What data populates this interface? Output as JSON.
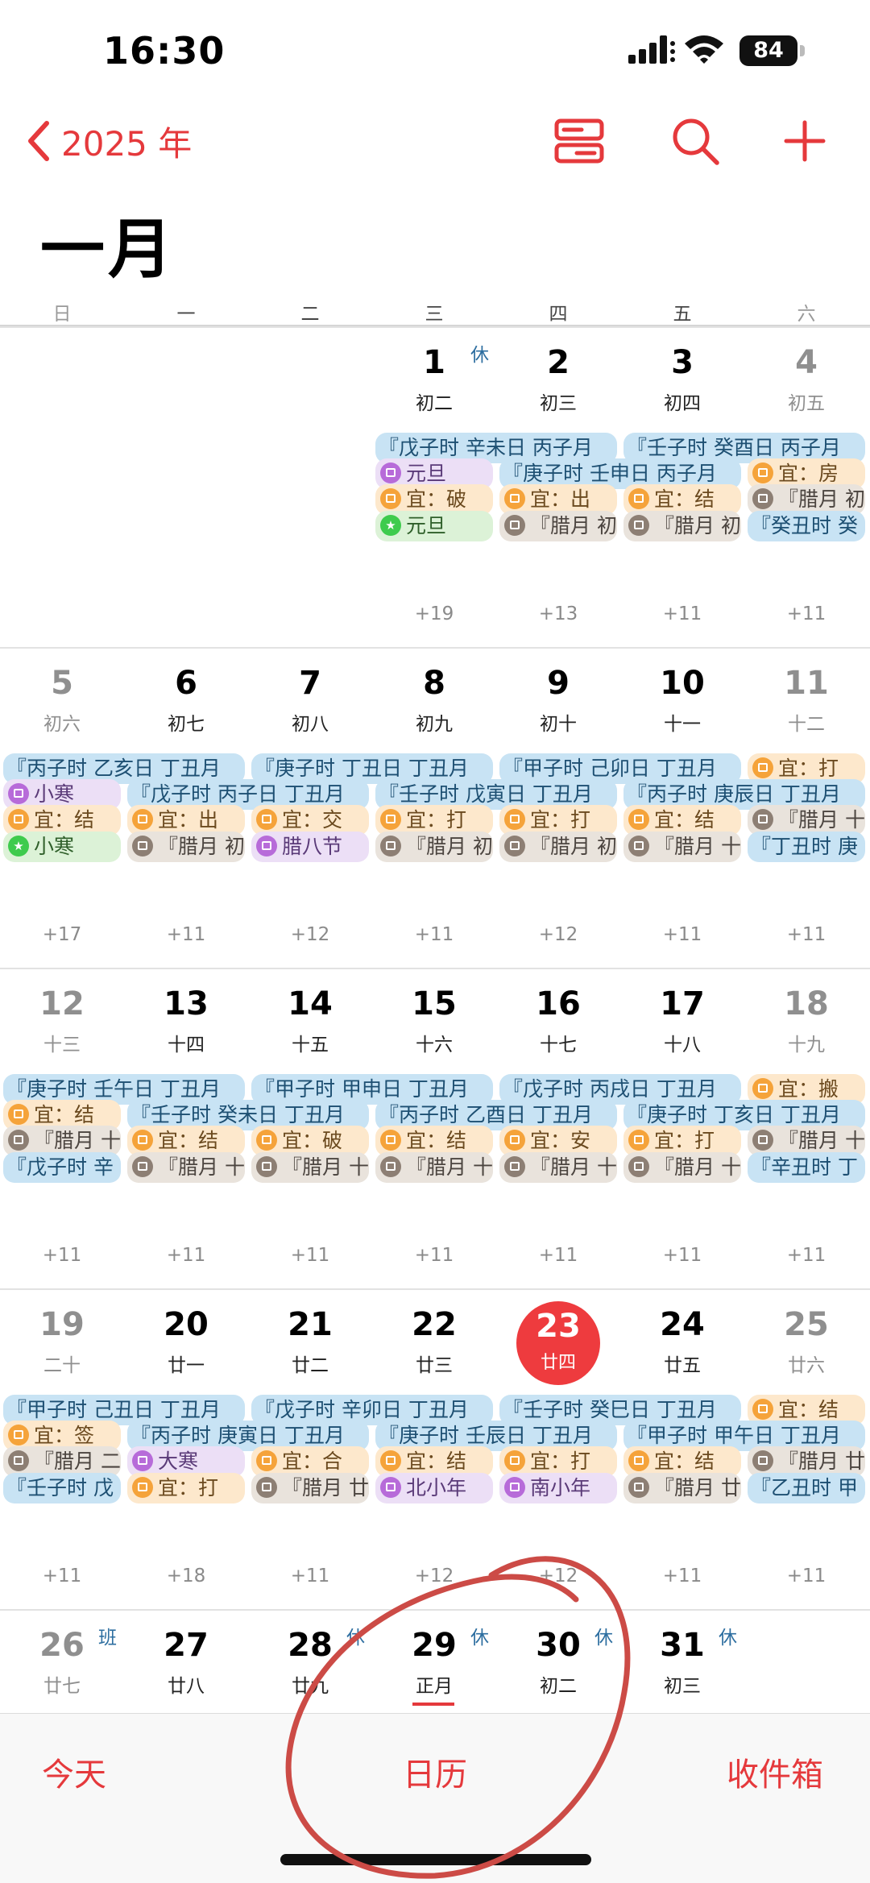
{
  "status": {
    "time": "16:30",
    "battery": "84"
  },
  "nav": {
    "back_label": "2025 年"
  },
  "month_title": "一月",
  "weekdays": [
    "日",
    "一",
    "二",
    "三",
    "四",
    "五",
    "六"
  ],
  "weeks": [
    {
      "days": [
        {
          "num": "",
          "lunar": "",
          "more": ""
        },
        {
          "num": "",
          "lunar": "",
          "more": ""
        },
        {
          "num": "",
          "lunar": "",
          "more": ""
        },
        {
          "num": "1",
          "lunar": "初二",
          "badge": "休",
          "more": "+19"
        },
        {
          "num": "2",
          "lunar": "初三",
          "more": "+13"
        },
        {
          "num": "3",
          "lunar": "初四",
          "more": "+11"
        },
        {
          "num": "4",
          "lunar": "初五",
          "more": "+11"
        }
      ],
      "events": [
        {
          "text": "『戊子时 辛未日 丙子月",
          "kind": "blue"
        },
        {
          "text": "『壬子时 癸酉日 丙子月",
          "kind": "blue"
        },
        {
          "text": "元旦",
          "kind": "purple"
        },
        {
          "text": "『庚子时 壬申日 丙子月",
          "kind": "blue"
        },
        {
          "text": "宜：房",
          "kind": "orange"
        },
        {
          "text": "宜：破",
          "kind": "orange"
        },
        {
          "text": "宜：出",
          "kind": "orange"
        },
        {
          "text": "宜：结",
          "kind": "orange"
        },
        {
          "text": "『腊月 初",
          "kind": "gray"
        },
        {
          "text": "元旦",
          "kind": "green"
        },
        {
          "text": "『腊月 初",
          "kind": "gray"
        },
        {
          "text": "『腊月 初",
          "kind": "gray"
        },
        {
          "text": "『癸丑时 癸",
          "kind": "blue"
        }
      ]
    },
    {
      "days": [
        {
          "num": "5",
          "lunar": "初六",
          "more": "+17"
        },
        {
          "num": "6",
          "lunar": "初七",
          "more": "+11"
        },
        {
          "num": "7",
          "lunar": "初八",
          "more": "+12"
        },
        {
          "num": "8",
          "lunar": "初九",
          "more": "+11"
        },
        {
          "num": "9",
          "lunar": "初十",
          "more": "+12"
        },
        {
          "num": "10",
          "lunar": "十一",
          "more": "+11"
        },
        {
          "num": "11",
          "lunar": "十二",
          "more": "+11"
        }
      ],
      "events": [
        {
          "text": "『丙子时 乙亥日 丁丑月",
          "kind": "blue"
        },
        {
          "text": "『庚子时 丁丑日 丁丑月",
          "kind": "blue"
        },
        {
          "text": "『甲子时 己卯日 丁丑月",
          "kind": "blue"
        },
        {
          "text": "宜：打",
          "kind": "orange"
        },
        {
          "text": "小寒",
          "kind": "purple"
        },
        {
          "text": "『戊子时 丙子日 丁丑月",
          "kind": "blue"
        },
        {
          "text": "『壬子时 戊寅日 丁丑月",
          "kind": "blue"
        },
        {
          "text": "『丙子时 庚辰日 丁丑月",
          "kind": "blue"
        },
        {
          "text": "宜：结",
          "kind": "orange"
        },
        {
          "text": "宜：出",
          "kind": "orange"
        },
        {
          "text": "宜：交",
          "kind": "orange"
        },
        {
          "text": "宜：打",
          "kind": "orange"
        },
        {
          "text": "宜：打",
          "kind": "orange"
        },
        {
          "text": "宜：结",
          "kind": "orange"
        },
        {
          "text": "『腊月 十",
          "kind": "gray"
        },
        {
          "text": "小寒",
          "kind": "green"
        },
        {
          "text": "『腊月 初",
          "kind": "gray"
        },
        {
          "text": "腊八节",
          "kind": "purple"
        },
        {
          "text": "『腊月 初",
          "kind": "gray"
        },
        {
          "text": "『腊月 初",
          "kind": "gray"
        },
        {
          "text": "『腊月 十",
          "kind": "gray"
        },
        {
          "text": "『丁丑时 庚",
          "kind": "blue"
        }
      ]
    },
    {
      "days": [
        {
          "num": "12",
          "lunar": "十三",
          "more": "+11"
        },
        {
          "num": "13",
          "lunar": "十四",
          "more": "+11"
        },
        {
          "num": "14",
          "lunar": "十五",
          "more": "+11"
        },
        {
          "num": "15",
          "lunar": "十六",
          "more": "+11"
        },
        {
          "num": "16",
          "lunar": "十七",
          "more": "+11"
        },
        {
          "num": "17",
          "lunar": "十八",
          "more": "+11"
        },
        {
          "num": "18",
          "lunar": "十九",
          "more": "+11"
        }
      ],
      "events": [
        {
          "text": "『庚子时 壬午日 丁丑月",
          "kind": "blue"
        },
        {
          "text": "『甲子时 甲申日 丁丑月",
          "kind": "blue"
        },
        {
          "text": "『戊子时 丙戌日 丁丑月",
          "kind": "blue"
        },
        {
          "text": "宜：搬",
          "kind": "orange"
        },
        {
          "text": "宜：结",
          "kind": "orange"
        },
        {
          "text": "『壬子时 癸未日 丁丑月",
          "kind": "blue"
        },
        {
          "text": "『丙子时 乙酉日 丁丑月",
          "kind": "blue"
        },
        {
          "text": "『庚子时 丁亥日 丁丑月",
          "kind": "blue"
        },
        {
          "text": "『腊月 十",
          "kind": "gray"
        },
        {
          "text": "宜：结",
          "kind": "orange"
        },
        {
          "text": "宜：破",
          "kind": "orange"
        },
        {
          "text": "宜：结",
          "kind": "orange"
        },
        {
          "text": "宜：安",
          "kind": "orange"
        },
        {
          "text": "宜：打",
          "kind": "orange"
        },
        {
          "text": "『腊月 十",
          "kind": "gray"
        },
        {
          "text": "『戊子时 辛",
          "kind": "blue"
        },
        {
          "text": "『腊月 十",
          "kind": "gray"
        },
        {
          "text": "『腊月 十",
          "kind": "gray"
        },
        {
          "text": "『腊月 十",
          "kind": "gray"
        },
        {
          "text": "『腊月 十",
          "kind": "gray"
        },
        {
          "text": "『腊月 十",
          "kind": "gray"
        },
        {
          "text": "『辛丑时 丁",
          "kind": "blue"
        }
      ]
    },
    {
      "days": [
        {
          "num": "19",
          "lunar": "二十",
          "more": "+11"
        },
        {
          "num": "20",
          "lunar": "廿一",
          "more": "+18"
        },
        {
          "num": "21",
          "lunar": "廿二",
          "more": "+11"
        },
        {
          "num": "22",
          "lunar": "廿三",
          "more": "+12"
        },
        {
          "num": "23",
          "lunar": "廿四",
          "more": "+12",
          "today": true
        },
        {
          "num": "24",
          "lunar": "廿五",
          "more": "+11"
        },
        {
          "num": "25",
          "lunar": "廿六",
          "more": "+11"
        }
      ],
      "events": [
        {
          "text": "『甲子时 己丑日 丁丑月",
          "kind": "blue"
        },
        {
          "text": "『戊子时 辛卯日 丁丑月",
          "kind": "blue"
        },
        {
          "text": "『壬子时 癸巳日 丁丑月",
          "kind": "blue"
        },
        {
          "text": "宜：结",
          "kind": "orange"
        },
        {
          "text": "宜：签",
          "kind": "orange"
        },
        {
          "text": "『丙子时 庚寅日 丁丑月",
          "kind": "blue"
        },
        {
          "text": "『庚子时 壬辰日 丁丑月",
          "kind": "blue"
        },
        {
          "text": "『甲子时 甲午日 丁丑月",
          "kind": "blue"
        },
        {
          "text": "『腊月 二",
          "kind": "gray"
        },
        {
          "text": "大寒",
          "kind": "purple"
        },
        {
          "text": "宜：合",
          "kind": "orange"
        },
        {
          "text": "宜：结",
          "kind": "orange"
        },
        {
          "text": "宜：打",
          "kind": "orange"
        },
        {
          "text": "宜：结",
          "kind": "orange"
        },
        {
          "text": "『腊月 廿",
          "kind": "gray"
        },
        {
          "text": "『壬子时 戊",
          "kind": "blue"
        },
        {
          "text": "宜：打",
          "kind": "orange"
        },
        {
          "text": "『腊月 廿",
          "kind": "gray"
        },
        {
          "text": "北小年",
          "kind": "purple"
        },
        {
          "text": "南小年",
          "kind": "purple"
        },
        {
          "text": "『腊月 廿",
          "kind": "gray"
        },
        {
          "text": "『乙丑时 甲",
          "kind": "blue"
        }
      ]
    },
    {
      "days": [
        {
          "num": "26",
          "lunar": "廿七",
          "badge": "班"
        },
        {
          "num": "27",
          "lunar": "廿八"
        },
        {
          "num": "28",
          "lunar": "廿九",
          "badge": "休"
        },
        {
          "num": "29",
          "lunar": "正月",
          "badge": "休"
        },
        {
          "num": "30",
          "lunar": "初二",
          "badge": "休"
        },
        {
          "num": "31",
          "lunar": "初三",
          "badge": "休"
        }
      ]
    }
  ],
  "tabs": {
    "today": "今天",
    "calendar": "日历",
    "inbox": "收件箱"
  },
  "colors": {
    "accent": "#e5393c",
    "today": "#ee3b3e",
    "event_blue": "#c8e3f4",
    "event_orange": "#fde8cc",
    "event_gray": "#e9e3dc",
    "event_purple": "#ecdff6",
    "event_green": "#dcf2d7"
  }
}
